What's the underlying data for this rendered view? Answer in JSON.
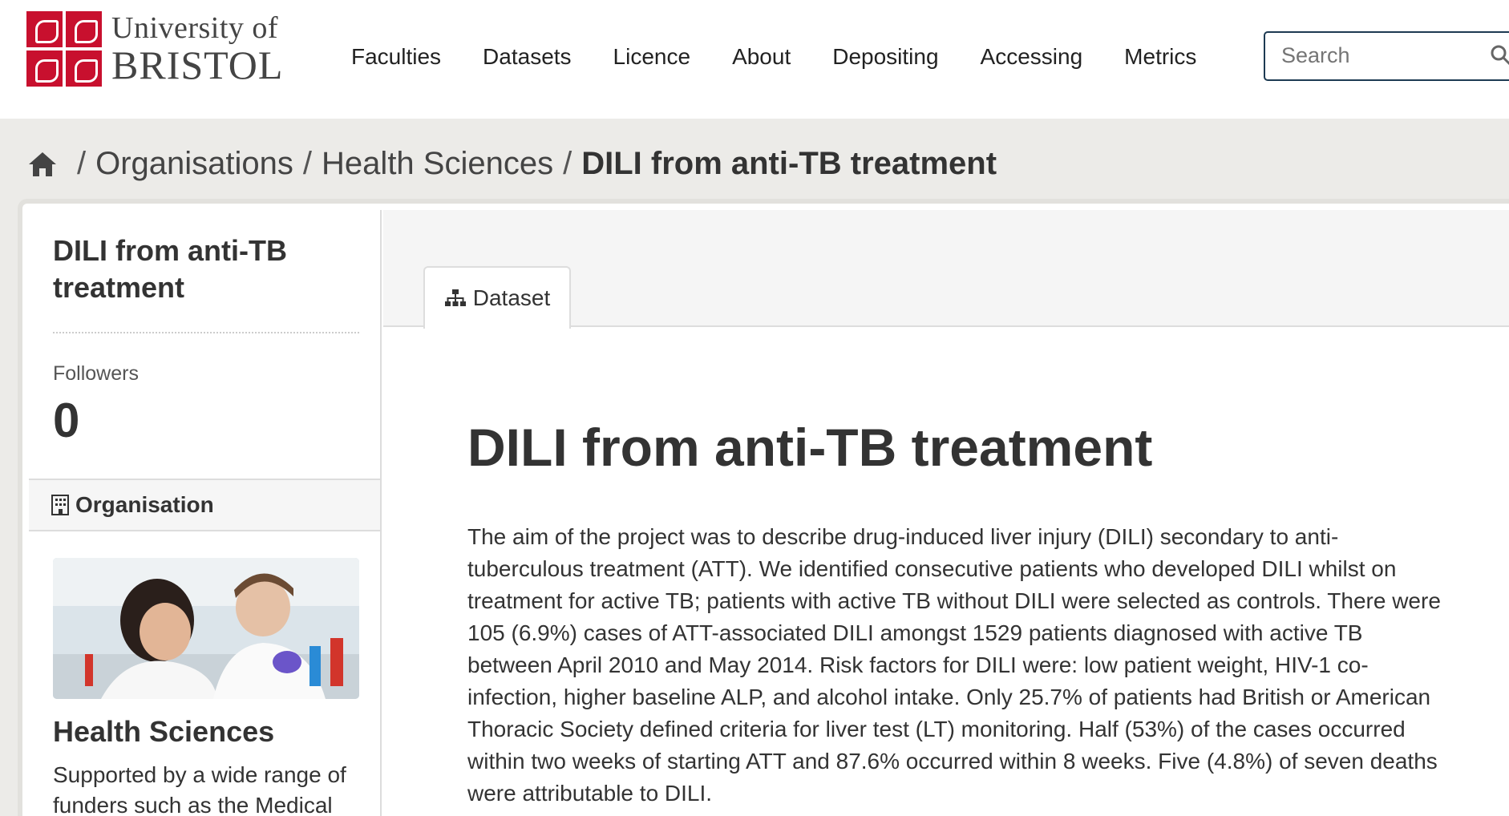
{
  "header": {
    "logo": {
      "line1": "University of",
      "line2": "BRISTOL"
    },
    "nav": [
      "Faculties",
      "Datasets",
      "Licence",
      "About",
      "Depositing",
      "Accessing",
      "Metrics"
    ],
    "search": {
      "placeholder": "Search"
    }
  },
  "breadcrumb": {
    "items": [
      "Organisations",
      "Health Sciences"
    ],
    "active": "DILI from anti-TB treatment",
    "separator": "/"
  },
  "sidebar": {
    "title": "DILI from anti-TB treatment",
    "followers_label": "Followers",
    "followers_count": "0",
    "org_heading": "Organisation",
    "org_name": "Health Sciences",
    "org_desc": "Supported by a wide range of funders such as the Medical"
  },
  "main": {
    "tab_label": "Dataset",
    "title": "DILI from anti-TB treatment",
    "description": "The aim of the project was to describe drug-induced liver injury (DILI) secondary to anti-tuberculous treatment (ATT). We identified consecutive patients who developed DILI whilst on treatment for active TB; patients with active TB without DILI were selected as controls. There were 105 (6.9%) cases of ATT-associated DILI amongst 1529 patients diagnosed with active TB between April 2010 and May 2014. Risk factors for DILI were: low patient weight, HIV-1 co-infection, higher baseline ALP, and alcohol intake. Only 25.7% of patients had British or American Thoracic Society defined criteria for liver test (LT) monitoring. Half (53%) of the cases occurred within two weeks of starting ATT and 87.6% occurred within 8 weeks. Five (4.8%) of seven deaths were attributable to DILI."
  },
  "colors": {
    "brand": "#c8102e",
    "band": "#ecebe8",
    "search_border": "#1d3a52"
  }
}
